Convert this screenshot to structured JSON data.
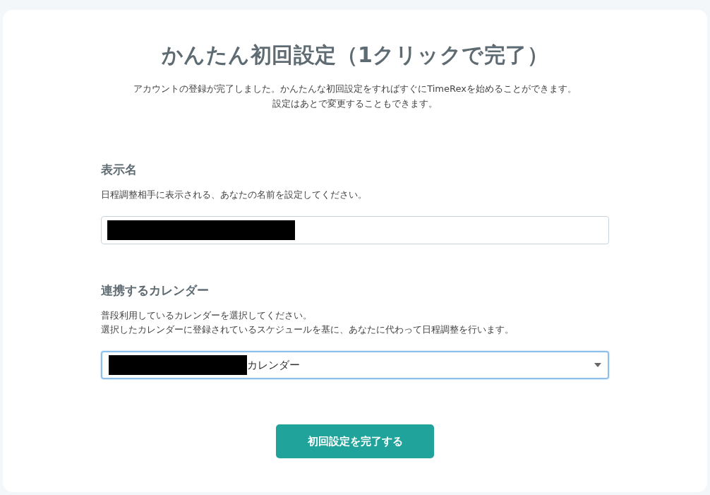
{
  "title": "かんたん初回設定（1クリックで完了）",
  "intro": [
    "アカウントの登録が完了しました。かんたんな初回設定をすればすぐにTimeRexを始めることができます。",
    "設定はあとで変更することもできます。"
  ],
  "fields": [
    {
      "kind": "text",
      "label": "表示名",
      "description": [
        "日程調整相手に表示される、あなたの名前を設定してください。"
      ],
      "redacted": true,
      "focused": false
    },
    {
      "kind": "select",
      "label": "連携するカレンダー",
      "description": [
        "普段利用しているカレンダーを選択してください。",
        "選択したカレンダーに登録されているスケジュールを基に、あなたに代わって日程調整を行います。"
      ],
      "redacted": true,
      "value": "カレンダー",
      "focused": true
    }
  ],
  "submit_button": "初回設定を完了する"
}
